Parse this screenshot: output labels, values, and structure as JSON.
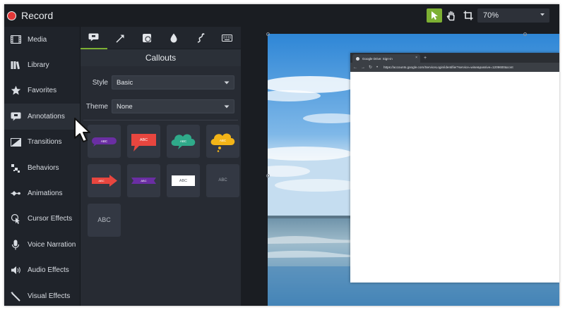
{
  "topbar": {
    "record_label": "Record",
    "tools": [
      "pointer-tool",
      "hand-tool",
      "crop-tool"
    ],
    "zoom": "70%"
  },
  "sidebar": {
    "items": [
      {
        "label": "Media",
        "icon": "film-icon"
      },
      {
        "label": "Library",
        "icon": "books-icon"
      },
      {
        "label": "Favorites",
        "icon": "star-icon"
      },
      {
        "label": "Annotations",
        "icon": "annotation-icon",
        "active": true
      },
      {
        "label": "Transitions",
        "icon": "transition-icon"
      },
      {
        "label": "Behaviors",
        "icon": "behaviors-icon"
      },
      {
        "label": "Animations",
        "icon": "animation-icon"
      },
      {
        "label": "Cursor Effects",
        "icon": "cursor-effects-icon"
      },
      {
        "label": "Voice Narration",
        "icon": "microphone-icon"
      },
      {
        "label": "Audio Effects",
        "icon": "speaker-icon"
      },
      {
        "label": "Visual Effects",
        "icon": "magic-wand-icon"
      }
    ]
  },
  "panel": {
    "tabs": [
      "callout-tab-icon",
      "arrow-tab-icon",
      "shape-tab-icon",
      "blur-tab-icon",
      "sketch-motion-tab-icon",
      "keystroke-tab-icon"
    ],
    "title": "Callouts",
    "style_label": "Style",
    "style_value": "Basic",
    "theme_label": "Theme",
    "theme_value": "None",
    "tile_texts": [
      "ABC",
      "ABC",
      "ABC",
      "ABC",
      "ABC",
      "ABC",
      "ABC",
      "ABC",
      "ABC"
    ]
  },
  "browser": {
    "tab_title": "Google Drive: Sign-in",
    "tab_close": "×",
    "new_tab": "+",
    "url": "https://accounts.google.com/ServiceLogin/identifier?service=wise&passive=1209600&cont"
  },
  "colors": {
    "accent_green": "#7db033",
    "record_red": "#e23838",
    "callout_purple": "#6a2ea3",
    "callout_red": "#e8463f",
    "callout_teal": "#2faa8a",
    "callout_yellow": "#f2b418"
  }
}
